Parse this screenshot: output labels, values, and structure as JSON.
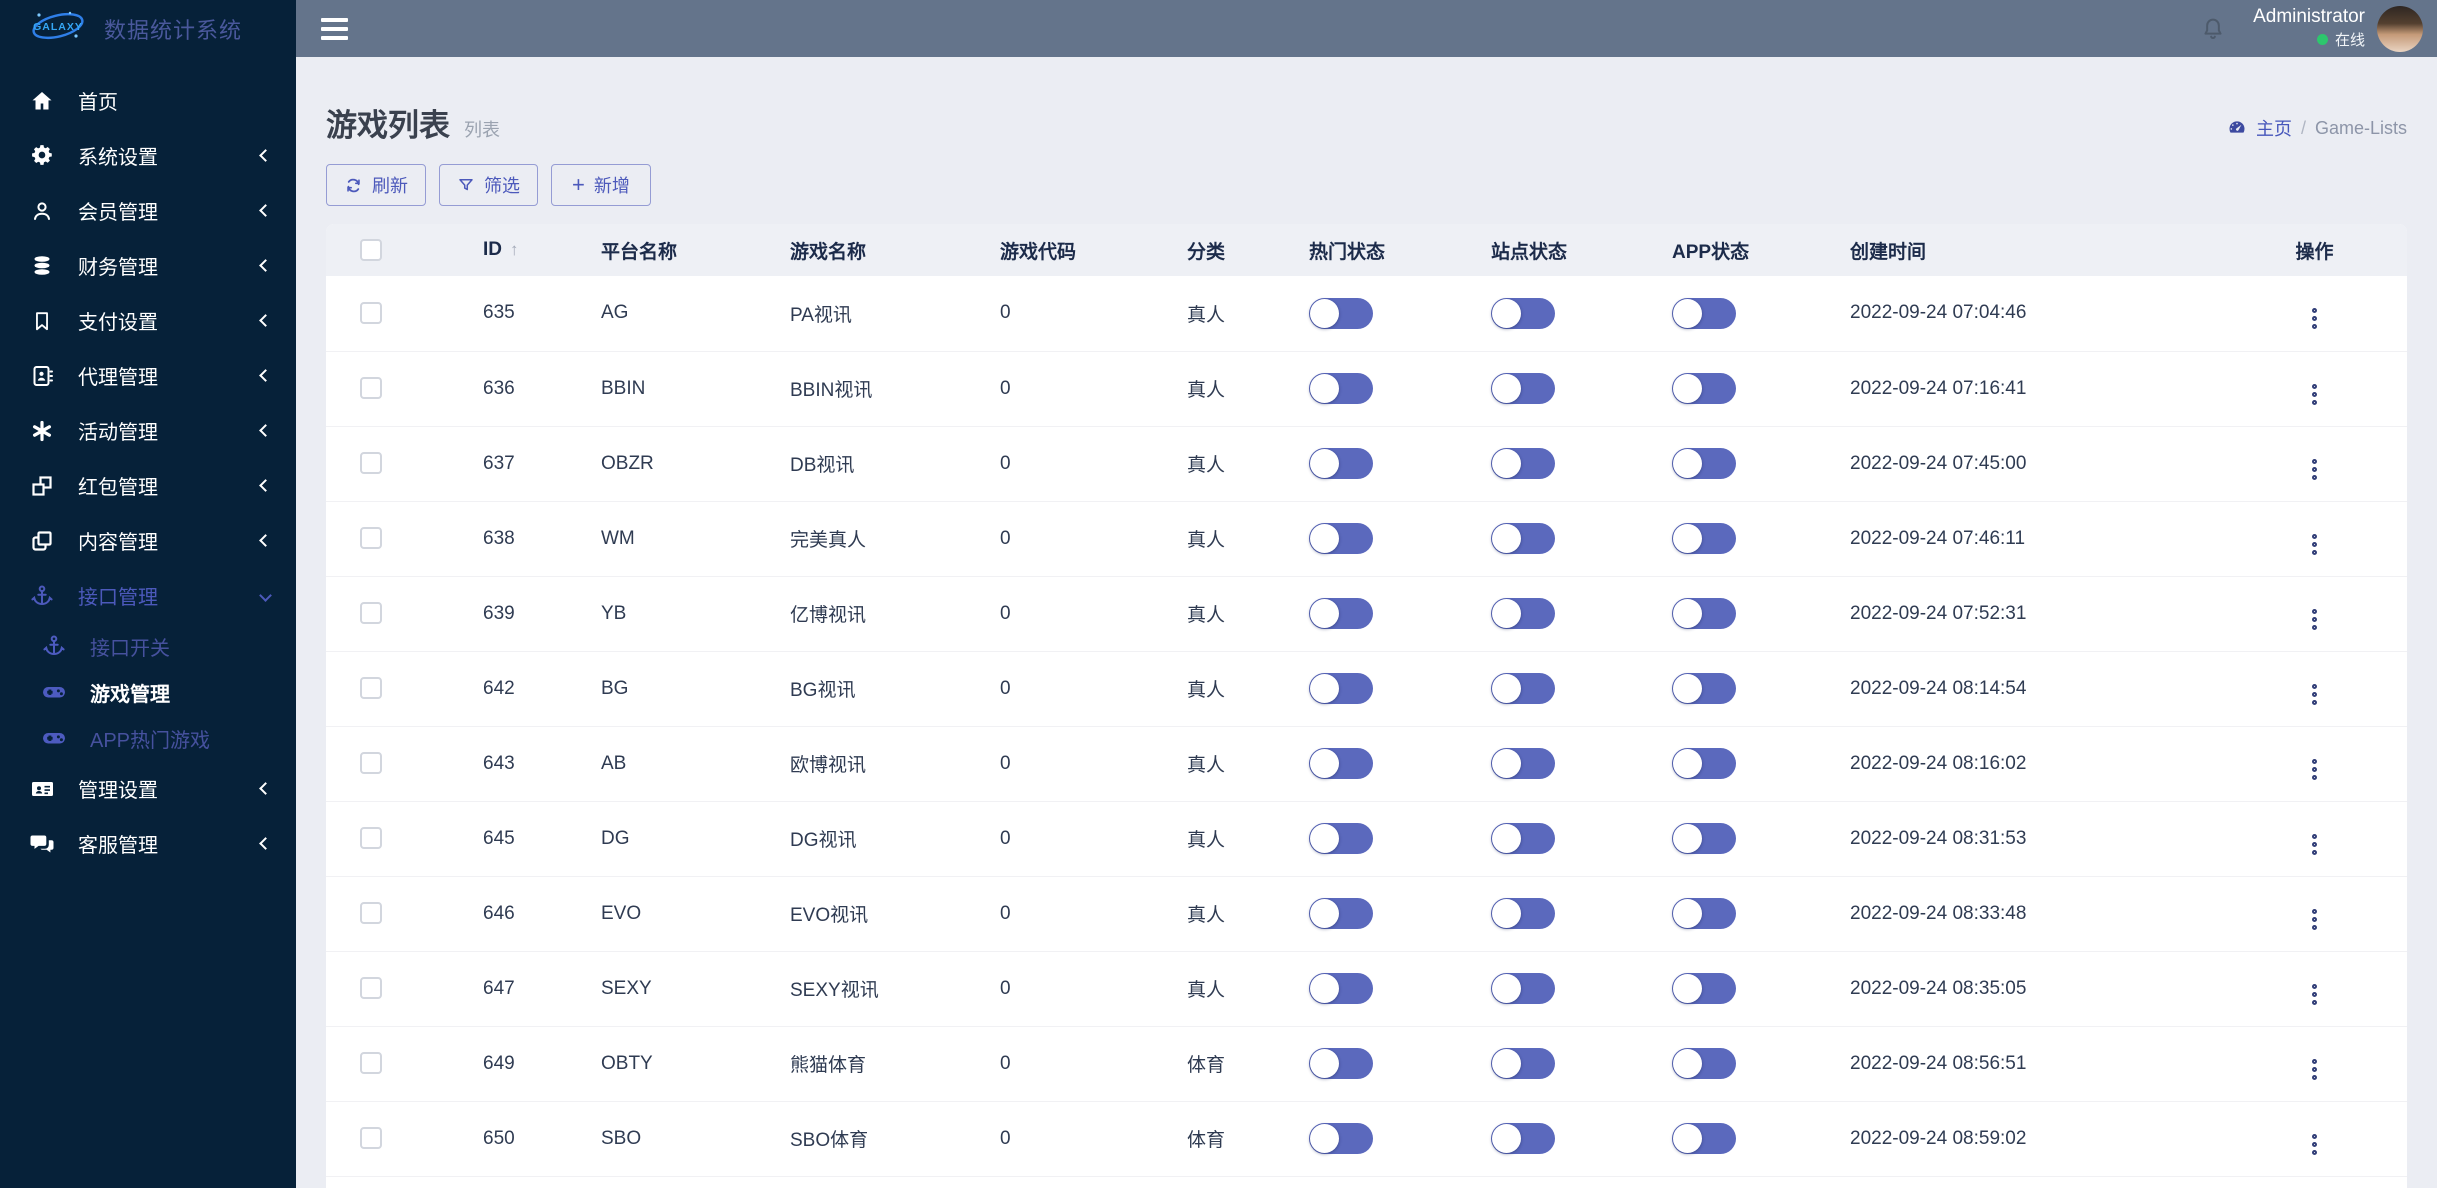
{
  "brand": {
    "logo_text": "GALAXY",
    "title": "数据统计系统"
  },
  "topbar": {
    "user_name": "Administrator",
    "online_label": "在线"
  },
  "sidebar": {
    "items": [
      {
        "label": "首页",
        "icon": "home-icon",
        "chevron": null
      },
      {
        "label": "系统设置",
        "icon": "gears-icon",
        "chevron": "left"
      },
      {
        "label": "会员管理",
        "icon": "user-icon",
        "chevron": "left"
      },
      {
        "label": "财务管理",
        "icon": "database-icon",
        "chevron": "left"
      },
      {
        "label": "支付设置",
        "icon": "bookmark-icon",
        "chevron": "left"
      },
      {
        "label": "代理管理",
        "icon": "address-book-icon",
        "chevron": "left"
      },
      {
        "label": "活动管理",
        "icon": "asterisk-icon",
        "chevron": "left"
      },
      {
        "label": "红包管理",
        "icon": "boxes-icon",
        "chevron": "left"
      },
      {
        "label": "内容管理",
        "icon": "clone-icon",
        "chevron": "left"
      },
      {
        "label": "接口管理",
        "icon": "anchor-icon",
        "chevron": "down",
        "active": true,
        "children": [
          {
            "label": "接口开关",
            "icon": "anchor-icon",
            "current": false
          },
          {
            "label": "游戏管理",
            "icon": "gamepad-icon",
            "current": true
          },
          {
            "label": "APP热门游戏",
            "icon": "gamepad-icon",
            "current": false
          }
        ]
      },
      {
        "label": "管理设置",
        "icon": "id-card-icon",
        "chevron": "left"
      },
      {
        "label": "客服管理",
        "icon": "comments-icon",
        "chevron": "left"
      }
    ]
  },
  "page": {
    "title": "游戏列表",
    "subtitle": "列表",
    "breadcrumb": {
      "home": "主页",
      "separator": "/",
      "current": "Game-Lists"
    },
    "toolbar": {
      "refresh": "刷新",
      "filter": "筛选",
      "add": "新增",
      "add_plus": "+"
    }
  },
  "table": {
    "headers": {
      "id": "ID",
      "platform": "平台名称",
      "game": "游戏名称",
      "code": "游戏代码",
      "category": "分类",
      "hot": "热门状态",
      "site": "站点状态",
      "app": "APP状态",
      "created": "创建时间",
      "actions": "操作"
    },
    "sort_icon": "↑",
    "rows": [
      {
        "id": "635",
        "platform": "AG",
        "game": "PA视讯",
        "code": "0",
        "category": "真人",
        "hot": false,
        "site": false,
        "app": false,
        "created": "2022-09-24 07:04:46"
      },
      {
        "id": "636",
        "platform": "BBIN",
        "game": "BBIN视讯",
        "code": "0",
        "category": "真人",
        "hot": false,
        "site": false,
        "app": false,
        "created": "2022-09-24 07:16:41"
      },
      {
        "id": "637",
        "platform": "OBZR",
        "game": "DB视讯",
        "code": "0",
        "category": "真人",
        "hot": false,
        "site": false,
        "app": false,
        "created": "2022-09-24 07:45:00"
      },
      {
        "id": "638",
        "platform": "WM",
        "game": "完美真人",
        "code": "0",
        "category": "真人",
        "hot": false,
        "site": false,
        "app": false,
        "created": "2022-09-24 07:46:11"
      },
      {
        "id": "639",
        "platform": "YB",
        "game": "亿博视讯",
        "code": "0",
        "category": "真人",
        "hot": false,
        "site": false,
        "app": false,
        "created": "2022-09-24 07:52:31"
      },
      {
        "id": "642",
        "platform": "BG",
        "game": "BG视讯",
        "code": "0",
        "category": "真人",
        "hot": false,
        "site": false,
        "app": false,
        "created": "2022-09-24 08:14:54"
      },
      {
        "id": "643",
        "platform": "AB",
        "game": "欧博视讯",
        "code": "0",
        "category": "真人",
        "hot": false,
        "site": false,
        "app": false,
        "created": "2022-09-24 08:16:02"
      },
      {
        "id": "645",
        "platform": "DG",
        "game": "DG视讯",
        "code": "0",
        "category": "真人",
        "hot": false,
        "site": false,
        "app": false,
        "created": "2022-09-24 08:31:53"
      },
      {
        "id": "646",
        "platform": "EVO",
        "game": "EVO视讯",
        "code": "0",
        "category": "真人",
        "hot": false,
        "site": false,
        "app": false,
        "created": "2022-09-24 08:33:48"
      },
      {
        "id": "647",
        "platform": "SEXY",
        "game": "SEXY视讯",
        "code": "0",
        "category": "真人",
        "hot": false,
        "site": false,
        "app": false,
        "created": "2022-09-24 08:35:05"
      },
      {
        "id": "649",
        "platform": "OBTY",
        "game": "熊猫体育",
        "code": "0",
        "category": "体育",
        "hot": false,
        "site": false,
        "app": false,
        "created": "2022-09-24 08:56:51"
      },
      {
        "id": "650",
        "platform": "SBO",
        "game": "SBO体育",
        "code": "0",
        "category": "体育",
        "hot": false,
        "site": false,
        "app": false,
        "created": "2022-09-24 08:59:02"
      }
    ]
  },
  "colors": {
    "accent": "#4c59bb",
    "toggle": "#5b69bd",
    "sidebar-bg": "#062139",
    "topbar-bg": "#64748b",
    "online": "#2dc76d",
    "brand-blue": "#35a7f5"
  }
}
